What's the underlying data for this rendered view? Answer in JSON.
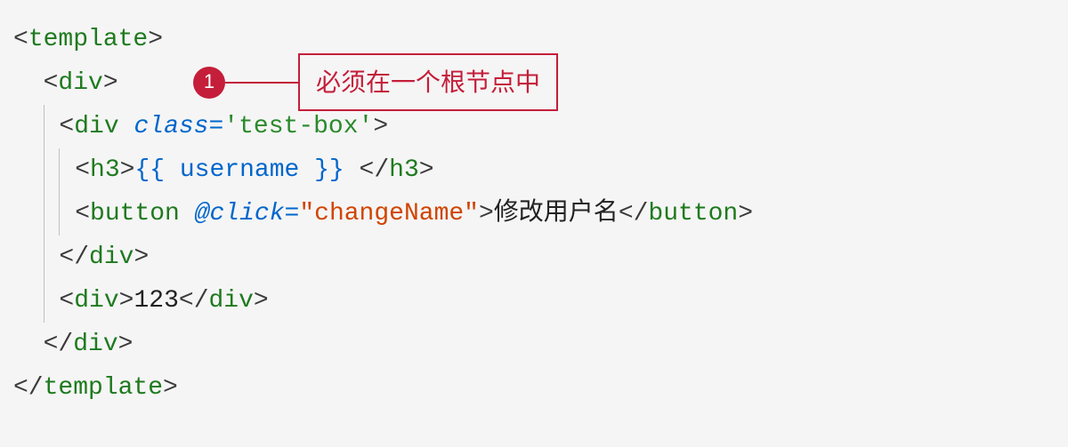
{
  "annotation": {
    "badge": "1",
    "label": "必须在一个根节点中"
  },
  "code": {
    "l1": {
      "open": "<",
      "tag": "template",
      "close": ">"
    },
    "l2": {
      "open": "<",
      "tag": "div",
      "close": ">"
    },
    "l3": {
      "open": "<",
      "tag": "div",
      "space": " ",
      "attr": "class",
      "eq": "=",
      "q1": "'",
      "val": "test-box",
      "q2": "'",
      "close": ">"
    },
    "l4": {
      "open": "<",
      "tag": "h3",
      "close": ">",
      "mustache": "{{ username }}",
      "space": " ",
      "open2": "</",
      "tag2": "h3",
      "close2": ">"
    },
    "l5": {
      "open": "<",
      "tag": "button",
      "space": " ",
      "attr": "@click",
      "eq": "=",
      "q1": "\"",
      "val": "changeName",
      "q2": "\"",
      "close": ">",
      "text": "修改用户名",
      "open2": "</",
      "tag2": "button",
      "close2": ">"
    },
    "l6": {
      "open": "</",
      "tag": "div",
      "close": ">"
    },
    "l7": {
      "open": "<",
      "tag": "div",
      "close": ">",
      "text": "123",
      "open2": "</",
      "tag2": "div",
      "close2": ">"
    },
    "l8": {
      "open": "</",
      "tag": "div",
      "close": ">"
    },
    "l9": {
      "open": "</",
      "tag": "template",
      "close": ">"
    }
  }
}
